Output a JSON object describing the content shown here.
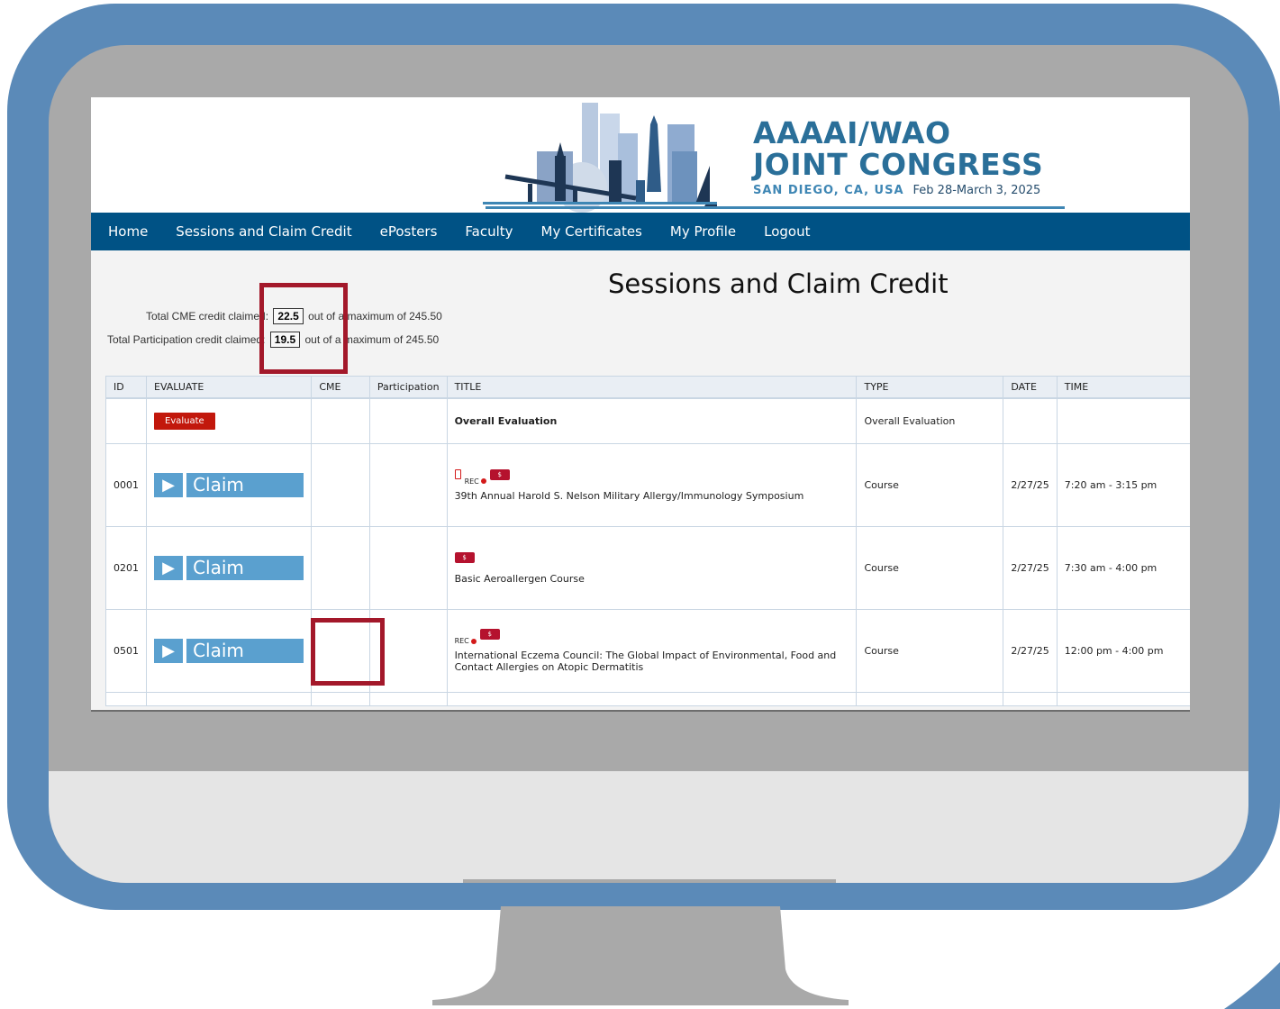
{
  "banner": {
    "title_line1": "AAAAI/WAO",
    "title_line2": "JOINT CONGRESS",
    "location": "SAN DIEGO, CA, USA",
    "dates": "Feb 28-March 3, 2025"
  },
  "nav": {
    "items": [
      "Home",
      "Sessions and Claim Credit",
      "ePosters",
      "Faculty",
      "My Certificates",
      "My Profile",
      "Logout"
    ]
  },
  "page": {
    "title": "Sessions and Claim Credit"
  },
  "credits": {
    "cme_label": "Total CME credit claimed:",
    "cme_value": "22.5",
    "participation_label": "Total Participation credit claimed:",
    "participation_value": "19.5",
    "suffix": "out of a maximum of 245.50"
  },
  "table": {
    "headers": [
      "ID",
      "EVALUATE",
      "CME",
      "Participation",
      "TITLE",
      "TYPE",
      "DATE",
      "TIME"
    ],
    "evaluate_label": "Evaluate",
    "claim_label": "Claim Credit",
    "rec_label": "REC",
    "fee_label": "$",
    "rows": [
      {
        "id": "",
        "title": "Overall Evaluation",
        "type": "Overall Evaluation",
        "date": "",
        "time": ""
      },
      {
        "id": "0001",
        "title": "39th Annual Harold S. Nelson Military Allergy/Immunology Symposium",
        "type": "Course",
        "date": "2/27/25",
        "time": "7:20 am - 3:15 pm"
      },
      {
        "id": "0201",
        "title": "Basic Aeroallergen Course",
        "type": "Course",
        "date": "2/27/25",
        "time": "7:30 am - 4:00 pm"
      },
      {
        "id": "0501",
        "title": "International Eczema Council: The Global Impact of Environmental, Food and Contact Allergies on Atopic Dermatitis",
        "type": "Course",
        "date": "2/27/25",
        "time": "12:00 pm - 4:00 pm"
      }
    ]
  },
  "colors": {
    "monitor": "#5b8ab8",
    "nav": "#005285",
    "claim_button": "#5aa0cf",
    "evaluate_button": "#c2180c",
    "highlight": "#a3182a"
  }
}
